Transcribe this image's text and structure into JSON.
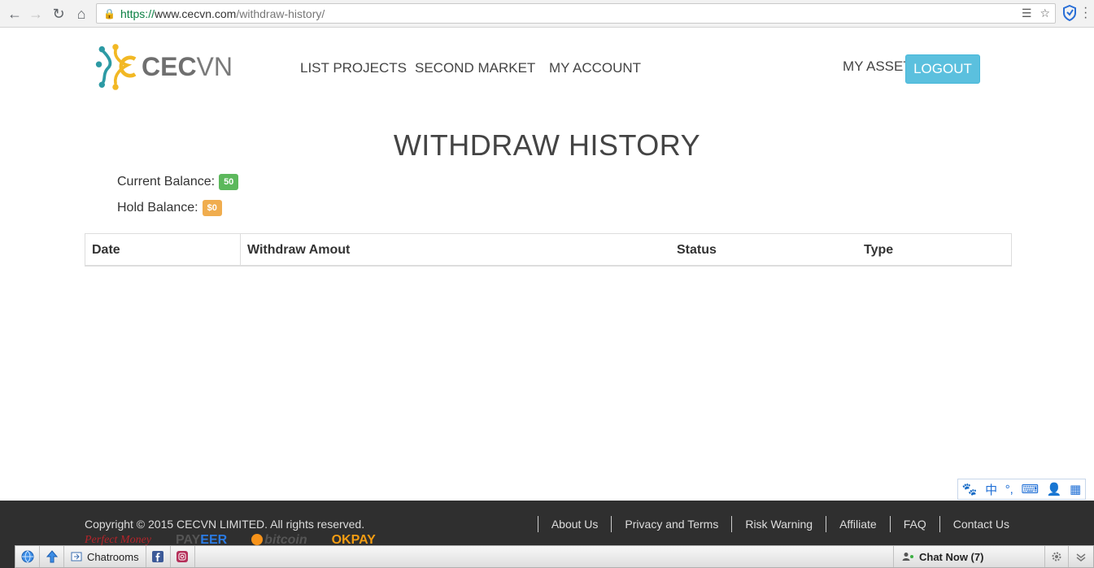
{
  "browser": {
    "url_scheme": "https://",
    "url_host": "www.cecvn.com",
    "url_path": "/withdraw-history/"
  },
  "header": {
    "logo_text_bold": "CEC",
    "logo_text_light": "VN",
    "nav": [
      "LIST PROJECTS",
      "SECOND MARKET",
      "MY ACCOUNT"
    ],
    "my_asset": "MY ASSET",
    "logout": "LOGOUT"
  },
  "main": {
    "title": "WITHDRAW HISTORY",
    "current_balance_label": "Current Balance:",
    "current_balance_value": "50",
    "hold_balance_label": "Hold Balance:",
    "hold_balance_value": "$0",
    "table_headers": [
      "Date",
      "Withdraw Amout",
      "Status",
      "Type"
    ]
  },
  "ime": {
    "items": [
      "🐾",
      "中",
      "°,",
      "⌨",
      "👤",
      "▦"
    ]
  },
  "footer": {
    "copyright": "Copyright © 2015 CECVN LIMITED. All rights reserved.",
    "links": [
      "About Us",
      "Privacy and Terms",
      "Risk Warning",
      "Affiliate",
      "FAQ",
      "Contact Us"
    ],
    "payments": {
      "perfect_money": "Perfect Money",
      "payeer_a": "PAY",
      "payeer_b": "EER",
      "bitcoin": "bitcoin",
      "okpay": "OKPAY"
    }
  },
  "toolbar": {
    "chatrooms": "Chatrooms",
    "chat_now": "Chat Now (7)"
  },
  "colors": {
    "logout_bg": "#5bc0de",
    "badge_green": "#5cb85c",
    "badge_orange": "#f0ad4e",
    "footer_bg": "#2f2f2f"
  }
}
